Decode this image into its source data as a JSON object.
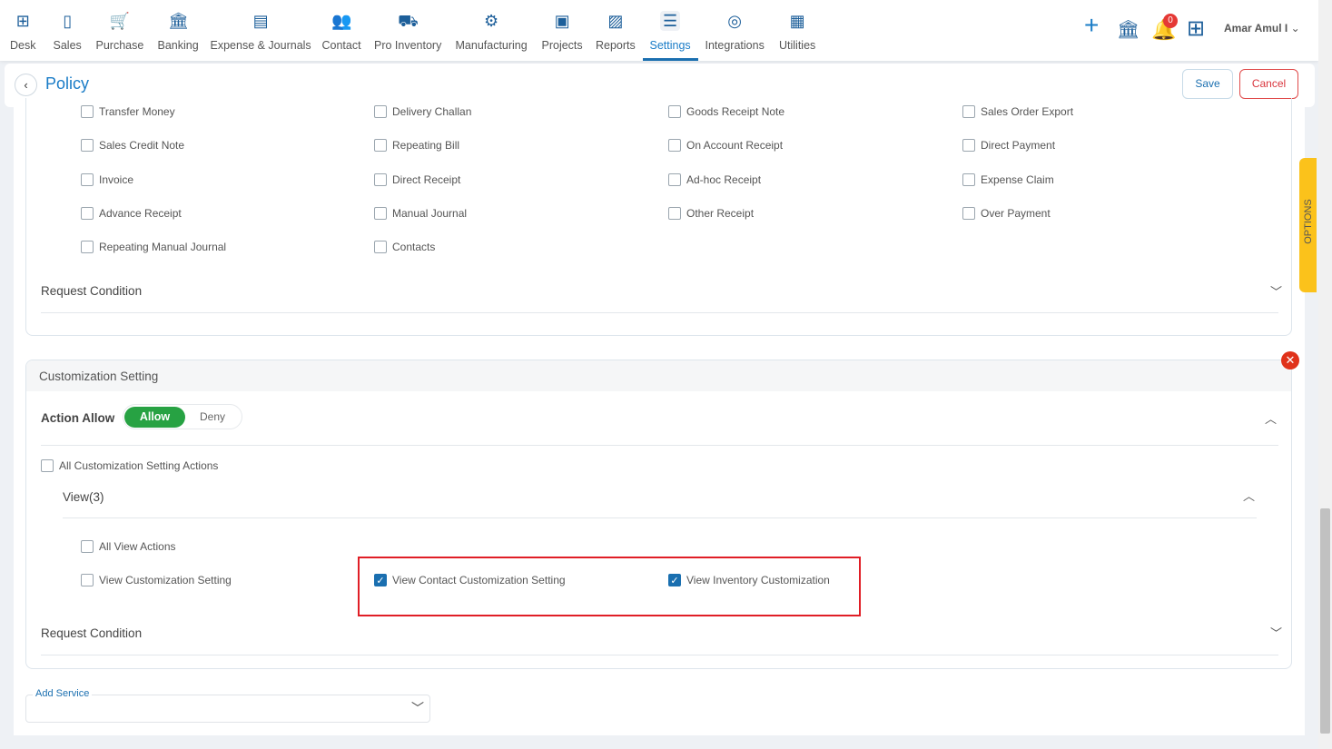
{
  "nav": {
    "items": [
      {
        "label": "Desk",
        "icon": "desk-icon",
        "glyph": "⊞"
      },
      {
        "label": "Sales",
        "icon": "sales-icon",
        "glyph": "▯"
      },
      {
        "label": "Purchase",
        "icon": "cart-icon",
        "glyph": "🛒"
      },
      {
        "label": "Banking",
        "icon": "bank-icon",
        "glyph": "🏛"
      },
      {
        "label": "Expense & Journals",
        "icon": "journal-icon",
        "glyph": "▤"
      },
      {
        "label": "Contact",
        "icon": "contact-icon",
        "glyph": "👥"
      },
      {
        "label": "Pro Inventory",
        "icon": "inventory-icon",
        "glyph": "⛟"
      },
      {
        "label": "Manufacturing",
        "icon": "manufacturing-icon",
        "glyph": "⚙"
      },
      {
        "label": "Projects",
        "icon": "projects-icon",
        "glyph": "▣"
      },
      {
        "label": "Reports",
        "icon": "reports-icon",
        "glyph": "▨"
      },
      {
        "label": "Settings",
        "icon": "settings-icon",
        "glyph": "☰"
      },
      {
        "label": "Integrations",
        "icon": "integrations-icon",
        "glyph": "◎"
      },
      {
        "label": "Utilities",
        "icon": "utilities-icon",
        "glyph": "▦"
      }
    ],
    "active": "Settings",
    "notifications": "0",
    "user": "Amar Amul I"
  },
  "header": {
    "title": "Policy",
    "save": "Save",
    "cancel": "Cancel"
  },
  "options_tab": "OPTIONS",
  "section1": {
    "rows": [
      [
        "Transfer Money",
        "Delivery Challan",
        "Goods Receipt Note",
        "Sales Order Export"
      ],
      [
        "Sales Credit Note",
        "Repeating Bill",
        "On Account Receipt",
        "Direct Payment"
      ],
      [
        "Invoice",
        "Direct Receipt",
        "Ad-hoc Receipt",
        "Expense Claim"
      ],
      [
        "Advance Receipt",
        "Manual Journal",
        "Other Receipt",
        "Over Payment"
      ],
      [
        "Repeating Manual Journal",
        "Contacts"
      ]
    ],
    "request_condition": "Request Condition"
  },
  "section2": {
    "title": "Customization Setting",
    "action_allow_label": "Action Allow",
    "allow": "Allow",
    "deny": "Deny",
    "selected": "Allow",
    "all_actions": "All Customization Setting Actions",
    "group": "View(3)",
    "all_view": "All View Actions",
    "items": [
      {
        "label": "View Customization Setting",
        "checked": false
      },
      {
        "label": "View Contact Customization Setting",
        "checked": true
      },
      {
        "label": "View Inventory Customization",
        "checked": true
      }
    ],
    "request_condition": "Request Condition"
  },
  "add_service": {
    "label": "Add Service",
    "value": ""
  },
  "colors": {
    "accent": "#1a7cc7",
    "allow": "#27a243",
    "highlight": "#e01e26",
    "options": "#fbc21b"
  }
}
